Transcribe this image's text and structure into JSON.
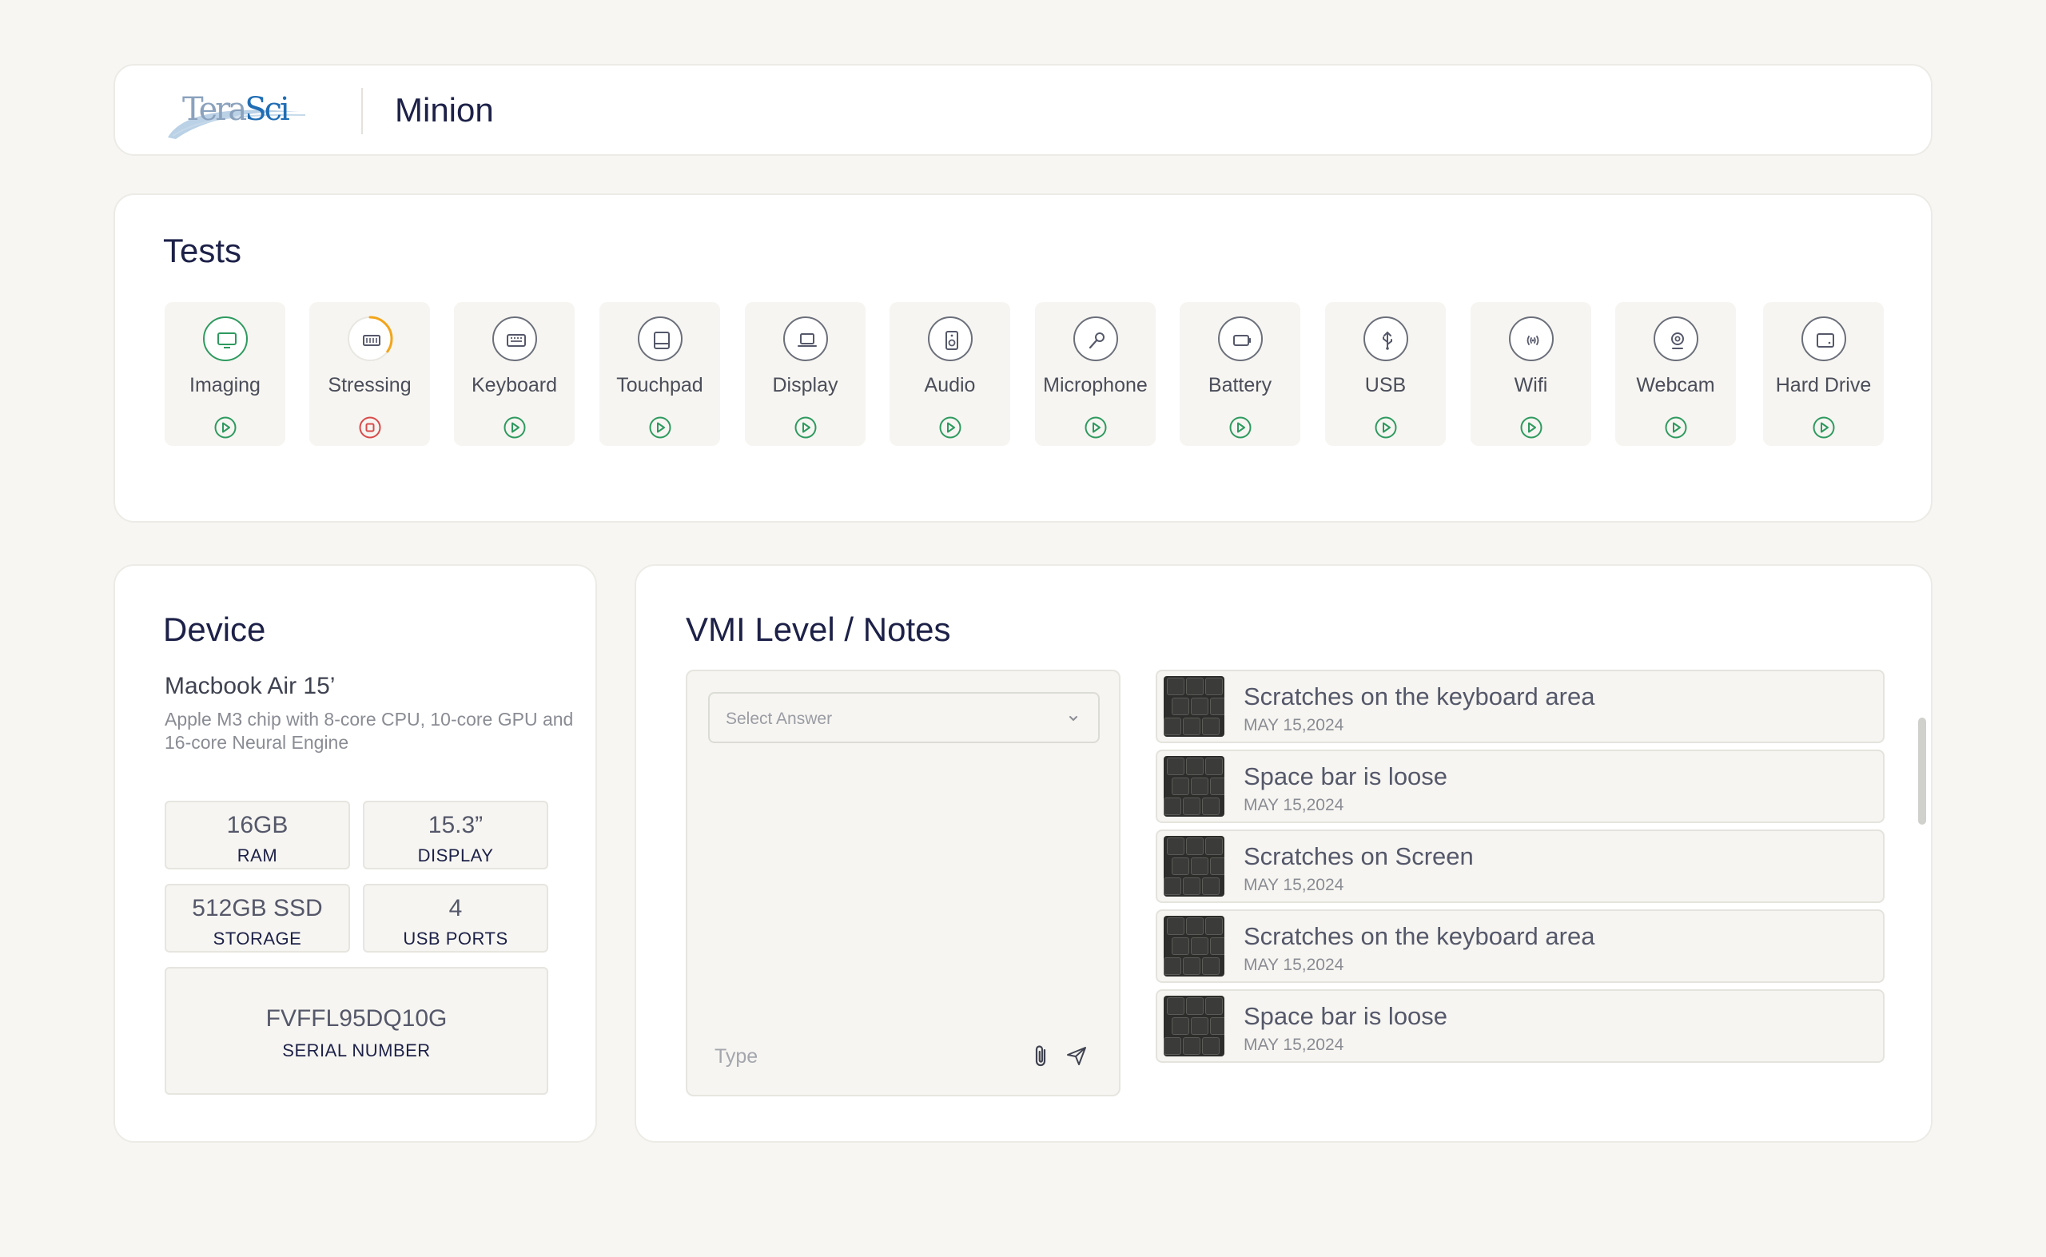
{
  "header": {
    "logo_text_a": "Tera",
    "logo_text_b": "Sci",
    "title": "Minion"
  },
  "tests": {
    "title": "Tests",
    "items": [
      {
        "label": "Imaging",
        "icon": "monitor-icon",
        "status": "done",
        "action": "play"
      },
      {
        "label": "Stressing",
        "icon": "memory-icon",
        "status": "running",
        "action": "stop"
      },
      {
        "label": "Keyboard",
        "icon": "keyboard-icon",
        "status": "idle",
        "action": "play"
      },
      {
        "label": "Touchpad",
        "icon": "touchpad-icon",
        "status": "idle",
        "action": "play"
      },
      {
        "label": "Display",
        "icon": "laptop-icon",
        "status": "idle",
        "action": "play"
      },
      {
        "label": "Audio",
        "icon": "speaker-icon",
        "status": "idle",
        "action": "play"
      },
      {
        "label": "Microphone",
        "icon": "microphone-icon",
        "status": "idle",
        "action": "play"
      },
      {
        "label": "Battery",
        "icon": "battery-icon",
        "status": "idle",
        "action": "play"
      },
      {
        "label": "USB",
        "icon": "usb-icon",
        "status": "idle",
        "action": "play"
      },
      {
        "label": "Wifi",
        "icon": "wifi-icon",
        "status": "idle",
        "action": "play"
      },
      {
        "label": "Webcam",
        "icon": "webcam-icon",
        "status": "idle",
        "action": "play"
      },
      {
        "label": "Hard Drive",
        "icon": "hard-drive-icon",
        "status": "idle",
        "action": "play"
      }
    ],
    "stressing_progress": 0.35
  },
  "device": {
    "title": "Device",
    "model": "Macbook Air 15’",
    "description": "Apple M3 chip with 8-core CPU, 10-core GPU and 16-core Neural Engine",
    "specs": {
      "ram": {
        "value": "16GB",
        "label": "RAM"
      },
      "display": {
        "value": "15.3”",
        "label": "DISPLAY"
      },
      "storage": {
        "value": "512GB SSD",
        "label": "STORAGE"
      },
      "usb": {
        "value": "4",
        "label": "USB PORTS"
      },
      "serial": {
        "value": "FVFFL95DQ10G",
        "label": "SERIAL NUMBER"
      }
    }
  },
  "notes": {
    "title": "VMI Level / Notes",
    "select_placeholder": "Select Answer",
    "type_placeholder": "Type",
    "items": [
      {
        "title": "Scratches on the keyboard area",
        "date": "MAY 15,2024"
      },
      {
        "title": "Space bar is loose",
        "date": "MAY 15,2024"
      },
      {
        "title": "Scratches on Screen",
        "date": "MAY 15,2024"
      },
      {
        "title": "Scratches on the keyboard area",
        "date": "MAY 15,2024"
      },
      {
        "title": "Space bar is loose",
        "date": "MAY 15,2024"
      }
    ]
  },
  "colors": {
    "accent_green": "#2e9a5f",
    "stop_red": "#d94a4a",
    "progress_amber": "#f2a51a",
    "text_navy": "#1d2148"
  }
}
